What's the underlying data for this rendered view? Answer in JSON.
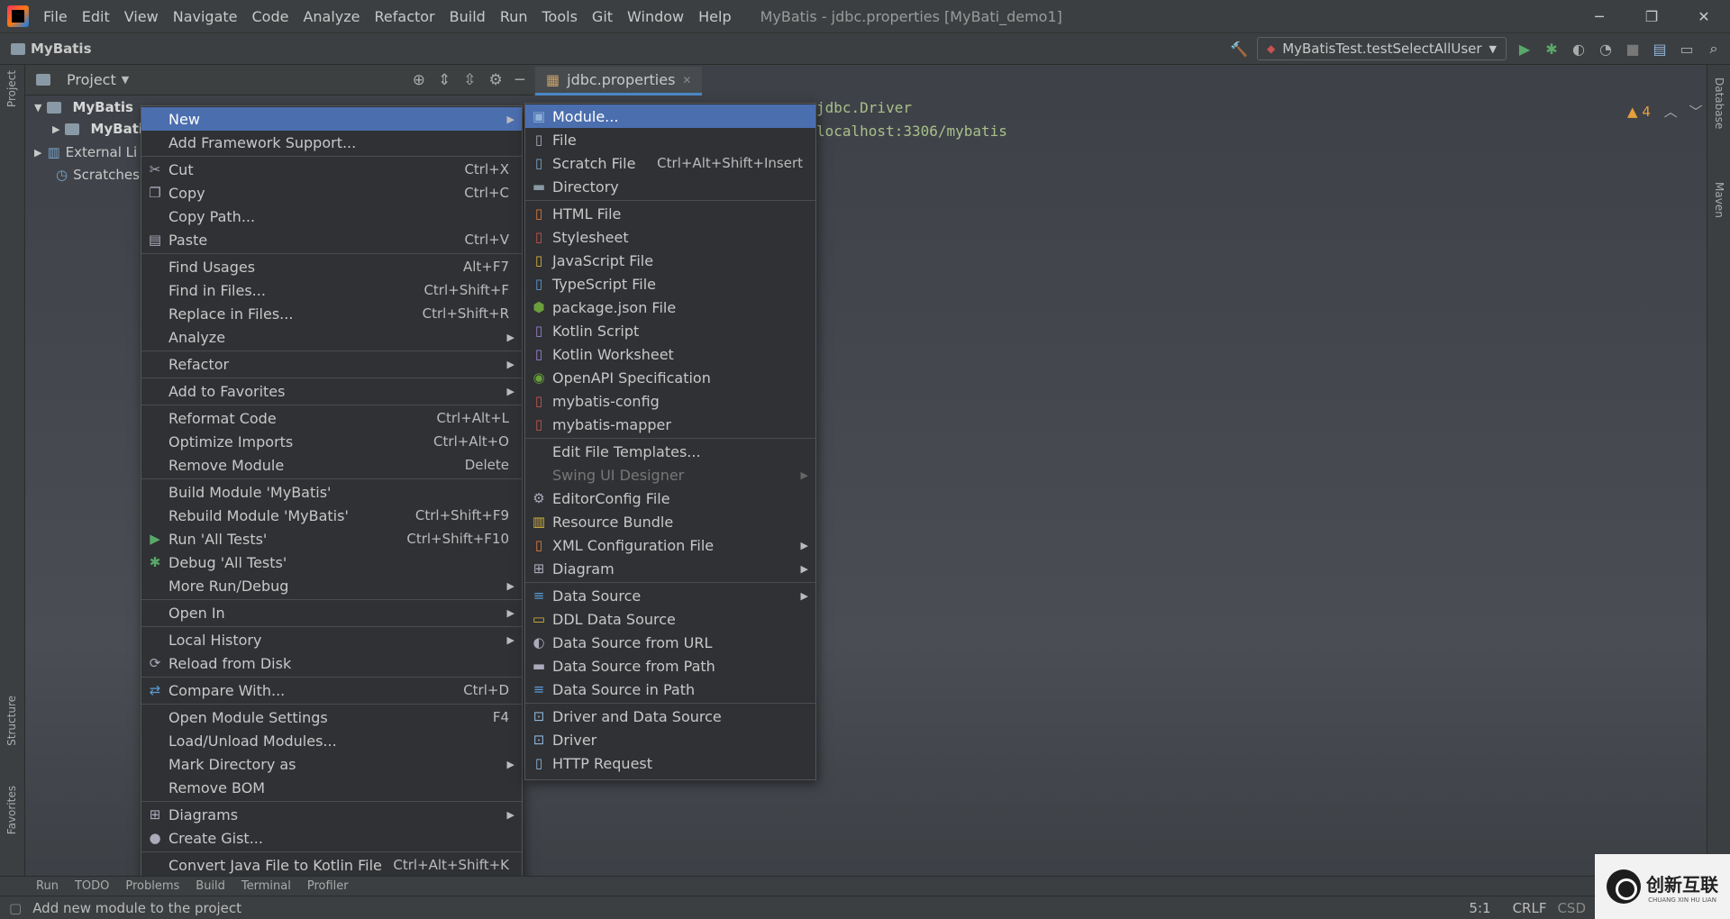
{
  "menubar": {
    "items": [
      "File",
      "Edit",
      "View",
      "Navigate",
      "Code",
      "Analyze",
      "Refactor",
      "Build",
      "Run",
      "Tools",
      "Git",
      "Window",
      "Help"
    ],
    "title": "MyBatis - jdbc.properties [MyBati_demo1]",
    "minimize": "─",
    "restore": "❐",
    "close": "✕"
  },
  "navbar": {
    "breadcrumb": "MyBatis",
    "run_config": "MyBatisTest.testSelectAllUser"
  },
  "project_panel": {
    "title": "Project",
    "tree": [
      "MyBatis",
      "MyBati",
      "External Li",
      "Scratches"
    ]
  },
  "editor": {
    "tab": "jdbc.properties",
    "line1": "jdbc.Driver",
    "line2": "localhost:3306/mybatis",
    "warnings": "4"
  },
  "context_menu": {
    "new": "New",
    "add_framework": "Add Framework Support...",
    "cut": "Cut",
    "cut_sc": "Ctrl+X",
    "copy": "Copy",
    "copy_sc": "Ctrl+C",
    "copy_path": "Copy Path...",
    "paste": "Paste",
    "paste_sc": "Ctrl+V",
    "find_usages": "Find Usages",
    "find_usages_sc": "Alt+F7",
    "find_in_files": "Find in Files...",
    "find_in_files_sc": "Ctrl+Shift+F",
    "replace_in_files": "Replace in Files...",
    "replace_in_files_sc": "Ctrl+Shift+R",
    "analyze": "Analyze",
    "refactor": "Refactor",
    "add_favorites": "Add to Favorites",
    "reformat": "Reformat Code",
    "reformat_sc": "Ctrl+Alt+L",
    "optimize": "Optimize Imports",
    "optimize_sc": "Ctrl+Alt+O",
    "remove_module": "Remove Module",
    "remove_module_sc": "Delete",
    "build_module": "Build Module 'MyBatis'",
    "rebuild_module": "Rebuild Module 'MyBatis'",
    "rebuild_module_sc": "Ctrl+Shift+F9",
    "run_tests": "Run 'All Tests'",
    "run_tests_sc": "Ctrl+Shift+F10",
    "debug_tests": "Debug 'All Tests'",
    "more_run": "More Run/Debug",
    "open_in": "Open In",
    "local_history": "Local History",
    "reload": "Reload from Disk",
    "compare": "Compare With...",
    "compare_sc": "Ctrl+D",
    "module_settings": "Open Module Settings",
    "module_settings_sc": "F4",
    "load_unload": "Load/Unload Modules...",
    "mark_dir": "Mark Directory as",
    "remove_bom": "Remove BOM",
    "diagrams": "Diagrams",
    "create_gist": "Create Gist...",
    "convert_kotlin": "Convert Java File to Kotlin File",
    "convert_kotlin_sc": "Ctrl+Alt+Shift+K"
  },
  "submenu": {
    "module": "Module...",
    "file": "File",
    "scratch": "Scratch File",
    "scratch_sc": "Ctrl+Alt+Shift+Insert",
    "directory": "Directory",
    "html": "HTML File",
    "stylesheet": "Stylesheet",
    "javascript": "JavaScript File",
    "typescript": "TypeScript File",
    "package_json": "package.json File",
    "kotlin_script": "Kotlin Script",
    "kotlin_worksheet": "Kotlin Worksheet",
    "openapi": "OpenAPI Specification",
    "mybatis_config": "mybatis-config",
    "mybatis_mapper": "mybatis-mapper",
    "edit_templates": "Edit File Templates...",
    "swing": "Swing UI Designer",
    "editorconfig": "EditorConfig File",
    "resource_bundle": "Resource Bundle",
    "xml_config": "XML Configuration File",
    "diagram": "Diagram",
    "data_source": "Data Source",
    "ddl_data_source": "DDL Data Source",
    "ds_url": "Data Source from URL",
    "ds_path": "Data Source from Path",
    "ds_in_path": "Data Source in Path",
    "driver_ds": "Driver and Data Source",
    "driver": "Driver",
    "http_request": "HTTP Request"
  },
  "bottom_tabs": [
    "Run",
    "TODO",
    "Problems",
    "Build",
    "Terminal",
    "Profiler"
  ],
  "left_tabs": {
    "project": "Project",
    "structure": "Structure",
    "favorites": "Favorites"
  },
  "right_tabs": {
    "database": "Database",
    "maven": "Maven"
  },
  "status": {
    "message": "Add new module to the project",
    "position": "5:1",
    "line_sep": "CRLF",
    "csdn": "CSD"
  },
  "watermark": {
    "text": "创新互联",
    "sub": "CHUANG XIN HU LIAN"
  }
}
